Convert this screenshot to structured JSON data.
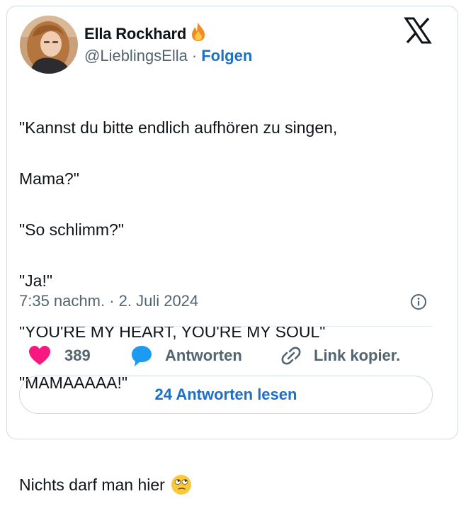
{
  "author": {
    "display_name": "Ella Rockhard",
    "handle": "@LieblingsElla",
    "separator": "·",
    "follow_label": "Folgen",
    "avatar_icon": "profile-photo",
    "name_emoji_icon": "fire-icon"
  },
  "brand": {
    "logo_icon": "x-logo-icon"
  },
  "tweet": {
    "lines": [
      "\"Kannst du bitte endlich aufhören zu singen,",
      "Mama?\"",
      "\"So schlimm?\"",
      "\"Ja!\"",
      "\"YOU'RE MY HEART, YOU'RE MY SOUL\"",
      "\"MAMAAAAA!\"",
      "",
      "Nichts darf man hier"
    ],
    "trailing_emoji_icon": "eye-roll-emoji-icon",
    "timestamp": "7:35 nachm. · 2. Juli 2024"
  },
  "actions": {
    "likes_count": "389",
    "reply_label": "Antworten",
    "copy_link_label": "Link kopier."
  },
  "read_replies_label": "24 Antworten lesen",
  "colors": {
    "like": "#f91880",
    "reply": "#1d9bf0",
    "link_blue": "#1d6fc8",
    "secondary_text": "#536471"
  }
}
